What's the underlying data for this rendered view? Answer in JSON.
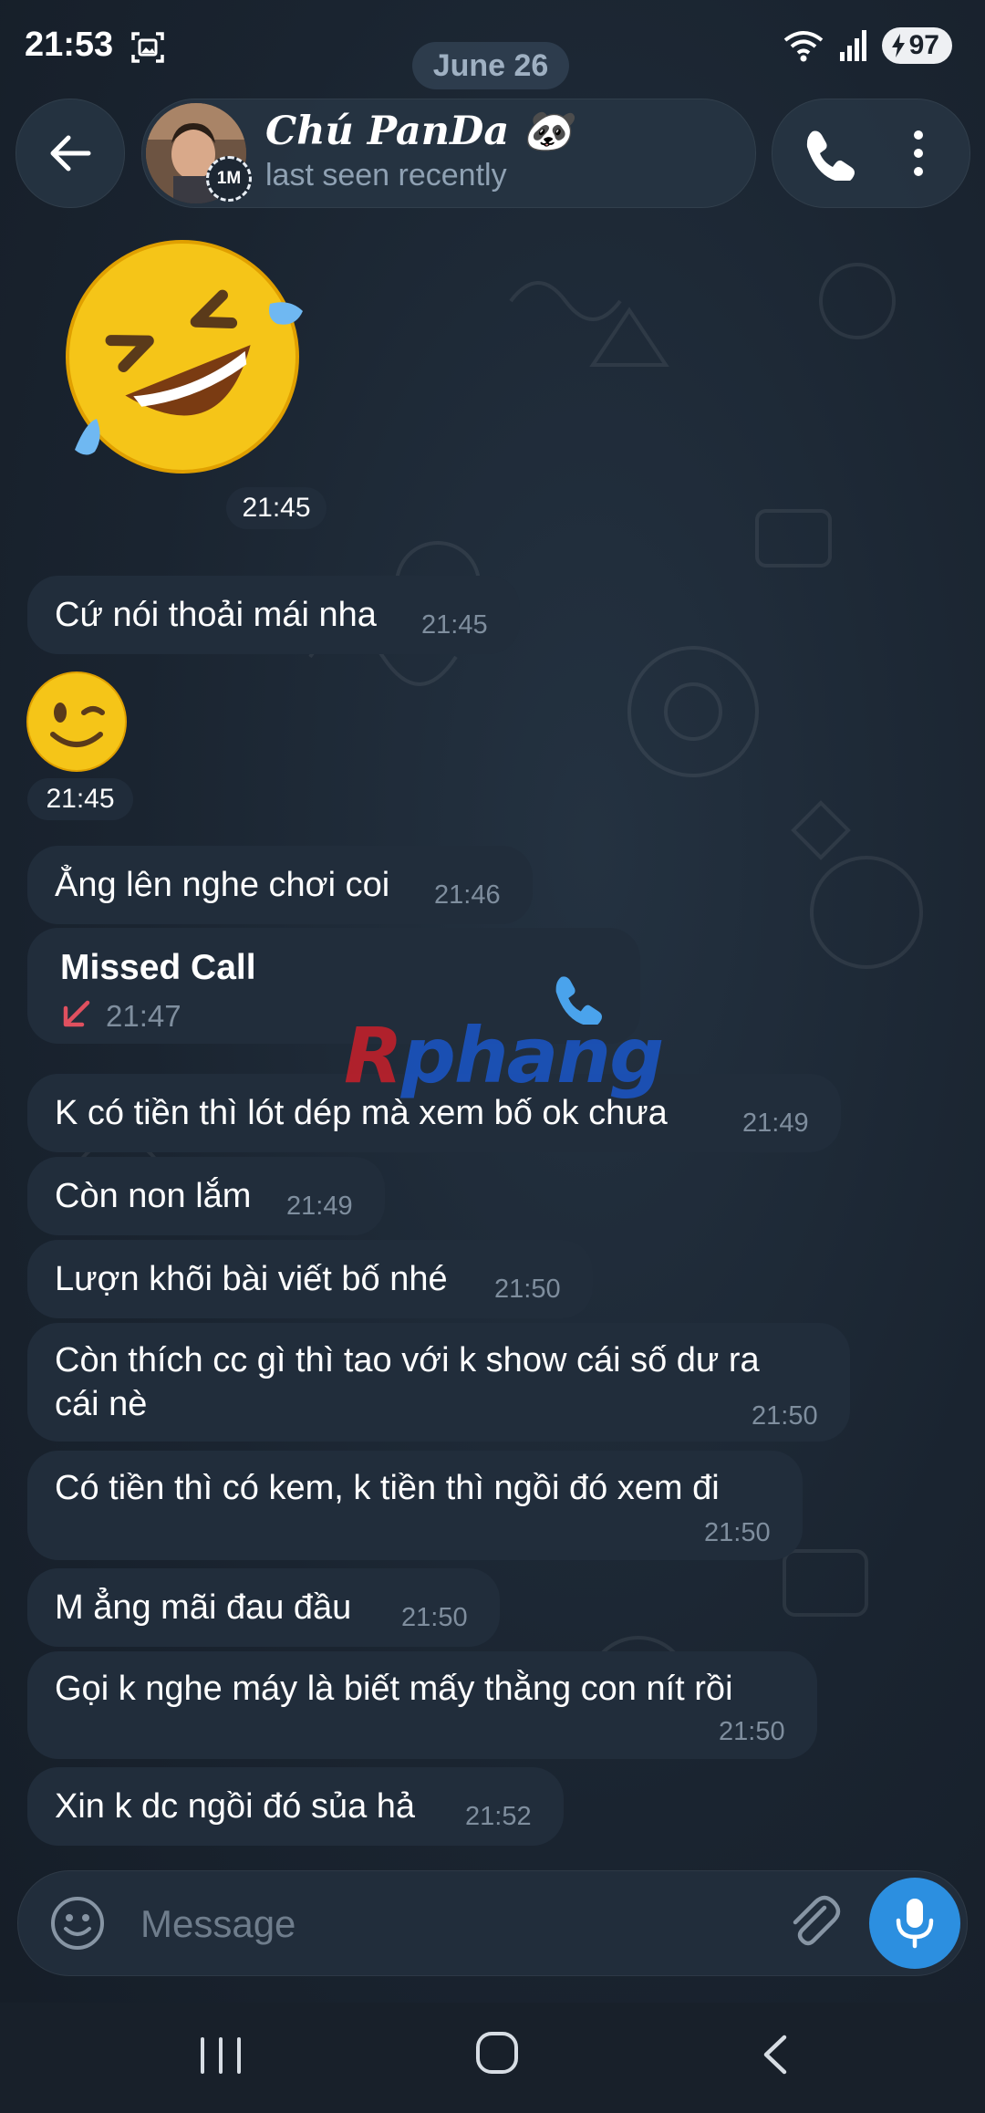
{
  "status_bar": {
    "time": "21:53",
    "battery": "97",
    "icons": [
      "screenshot-icon",
      "wifi-icon",
      "signal-icon",
      "battery-icon"
    ]
  },
  "date_label": "June 26",
  "header": {
    "contact_name": "Chú PanDa 🐼",
    "status": "last seen recently",
    "avatar_badge": "1M"
  },
  "messages": [
    {
      "kind": "emoji",
      "emoji": "🤣",
      "time": "21:45"
    },
    {
      "kind": "text",
      "text": "Cứ nói thoải mái nha",
      "time": "21:45"
    },
    {
      "kind": "emoji",
      "emoji": "😉",
      "time": "21:45"
    },
    {
      "kind": "text",
      "text": "Ẳng lên nghe chơi coi",
      "time": "21:46"
    },
    {
      "kind": "call",
      "title": "Missed Call",
      "time": "21:47"
    },
    {
      "kind": "text",
      "text": "K có tiền thì lót dép mà xem bố ok chưa",
      "time": "21:49"
    },
    {
      "kind": "text",
      "text": "Còn non lắm",
      "time": "21:49"
    },
    {
      "kind": "text",
      "text": "Lượn khõi bài viết bố nhé",
      "time": "21:50"
    },
    {
      "kind": "text",
      "text_line1": "Còn thích cc gì thì tao với k show cái số dư ra",
      "text_line2": "cái nè",
      "time": "21:50"
    },
    {
      "kind": "text",
      "text": "Có tiền thì có kem, k tiền thì ngồi đó xem đi",
      "time": "21:50"
    },
    {
      "kind": "text",
      "text": "M ẳng mãi đau đầu",
      "time": "21:50"
    },
    {
      "kind": "text",
      "text": "Gọi k nghe máy là biết mấy thằng con nít rồi",
      "time": "21:50"
    },
    {
      "kind": "text",
      "text": "Xin k dc ngồi đó sủa hả",
      "time": "21:52"
    }
  ],
  "watermark": {
    "first": "R",
    "rest": "phang"
  },
  "composer": {
    "placeholder": "Message"
  },
  "colors": {
    "background": "#18222d",
    "bubble": "#212d3b",
    "accent": "#2c8fe0",
    "missed_arrow": "#e0505f",
    "timestamp": "#7f8e9e"
  }
}
